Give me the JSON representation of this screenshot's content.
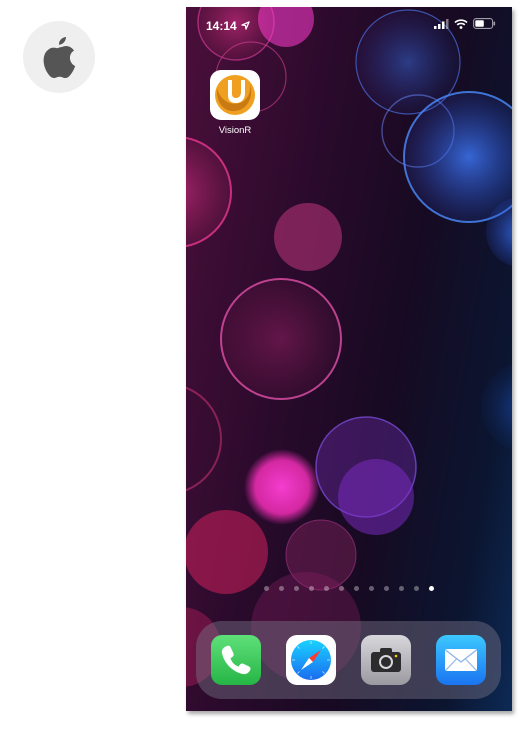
{
  "status_bar": {
    "time": "14:14"
  },
  "home_screen": {
    "apps": [
      {
        "label": "VisionR",
        "icon": "visionr-logo-icon"
      }
    ],
    "page_indicator": {
      "total_pages": 12,
      "current_page": 12
    }
  },
  "dock": {
    "apps": [
      {
        "icon": "phone-icon",
        "color": "#34c759"
      },
      {
        "icon": "safari-icon",
        "color": "#1a8cff"
      },
      {
        "icon": "camera-icon",
        "color": "#8e8e93"
      },
      {
        "icon": "mail-icon",
        "color": "#1e90ff"
      }
    ]
  },
  "colors": {
    "apple_badge_bg": "#efefef",
    "apple_logo": "#555555",
    "visionr_orange": "#f0a020"
  }
}
